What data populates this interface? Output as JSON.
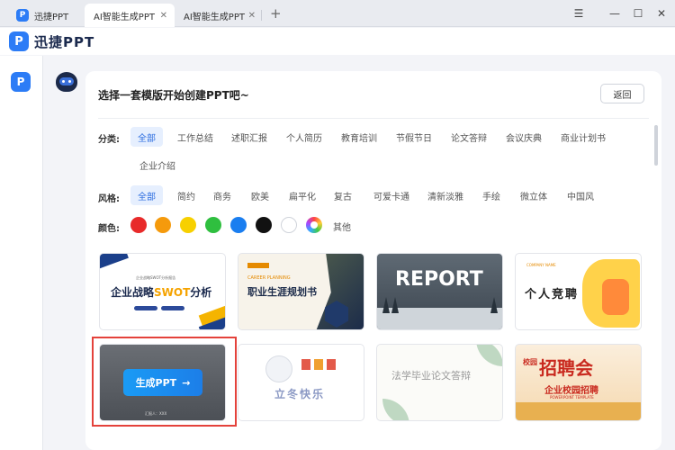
{
  "tabs": {
    "app": "迅捷PPT",
    "items": [
      {
        "label": "AI智能生成PPT",
        "close": "✕"
      },
      {
        "label": "AI智能生成PPT",
        "close": "✕"
      }
    ],
    "add": "+"
  },
  "window": {
    "menu": "☰",
    "minimize": "—",
    "maximize": "☐",
    "close": "✕"
  },
  "header": {
    "logo_glyph": "P",
    "brand": "迅捷PPT"
  },
  "sidebar": {
    "icon_glyph": "P"
  },
  "card": {
    "title": "选择一套模版开始创建PPT吧~",
    "back": "返回"
  },
  "filters": {
    "category_label": "分类:",
    "categories": [
      "全部",
      "工作总结",
      "述职汇报",
      "个人简历",
      "教育培训",
      "节假节日",
      "论文答辩",
      "会议庆典",
      "商业计划书",
      "企业介绍"
    ],
    "style_label": "风格:",
    "styles": [
      "全部",
      "简约",
      "商务",
      "欧美",
      "扁平化",
      "复古",
      "可爱卡通",
      "清新淡雅",
      "手绘",
      "微立体",
      "中国风"
    ],
    "color_label": "颜色:",
    "colors": [
      "#e82a2a",
      "#f59a0c",
      "#f7d000",
      "#2fbf3f",
      "#1a7ef0",
      "#111111",
      "#ffffff"
    ],
    "other": "其他"
  },
  "templates": {
    "t1": {
      "top": "企业战略SWOT分析报告",
      "main_a": "企业战略",
      "main_b": "SWOT",
      "main_c": "分析"
    },
    "t2": {
      "en": "CAREER PLANNING",
      "main": "职业生涯规划书"
    },
    "t3": {
      "main": "REPORT"
    },
    "t4": {
      "tag": "COMPANY NAME",
      "main": "个人竞聘"
    },
    "t5": {
      "author": "汇报人：XXX"
    },
    "t6": {
      "main": "立冬快乐"
    },
    "t7": {
      "main": "法学毕业论文答辩"
    },
    "t8": {
      "badge": "校园",
      "main": "招聘会",
      "sub": "企业校园招聘",
      "en": "POWERPOINT TEMPLATE"
    }
  },
  "generate": {
    "label": "生成PPT",
    "arrow": "→"
  }
}
